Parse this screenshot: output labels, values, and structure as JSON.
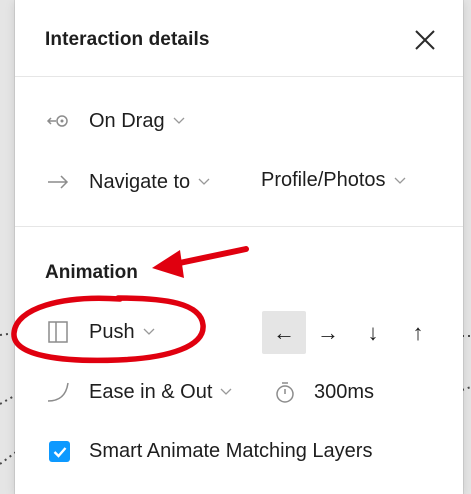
{
  "panel": {
    "title": "Interaction details"
  },
  "trigger": {
    "label": "On Drag",
    "icon": "drag-trigger-icon"
  },
  "action": {
    "label": "Navigate to",
    "destination": "Profile/Photos",
    "icon": "arrow-right-icon"
  },
  "animation": {
    "section_title": "Animation",
    "type": "Push",
    "easing": "Ease in & Out",
    "duration": "300ms",
    "directions": [
      "←",
      "→",
      "↓",
      "↑"
    ],
    "active_direction": "←",
    "smart_animate_label": "Smart Animate Matching Layers",
    "smart_animate_checked": true
  },
  "colors": {
    "checkbox": "#0d99ff",
    "annotation": "#e0000f"
  }
}
